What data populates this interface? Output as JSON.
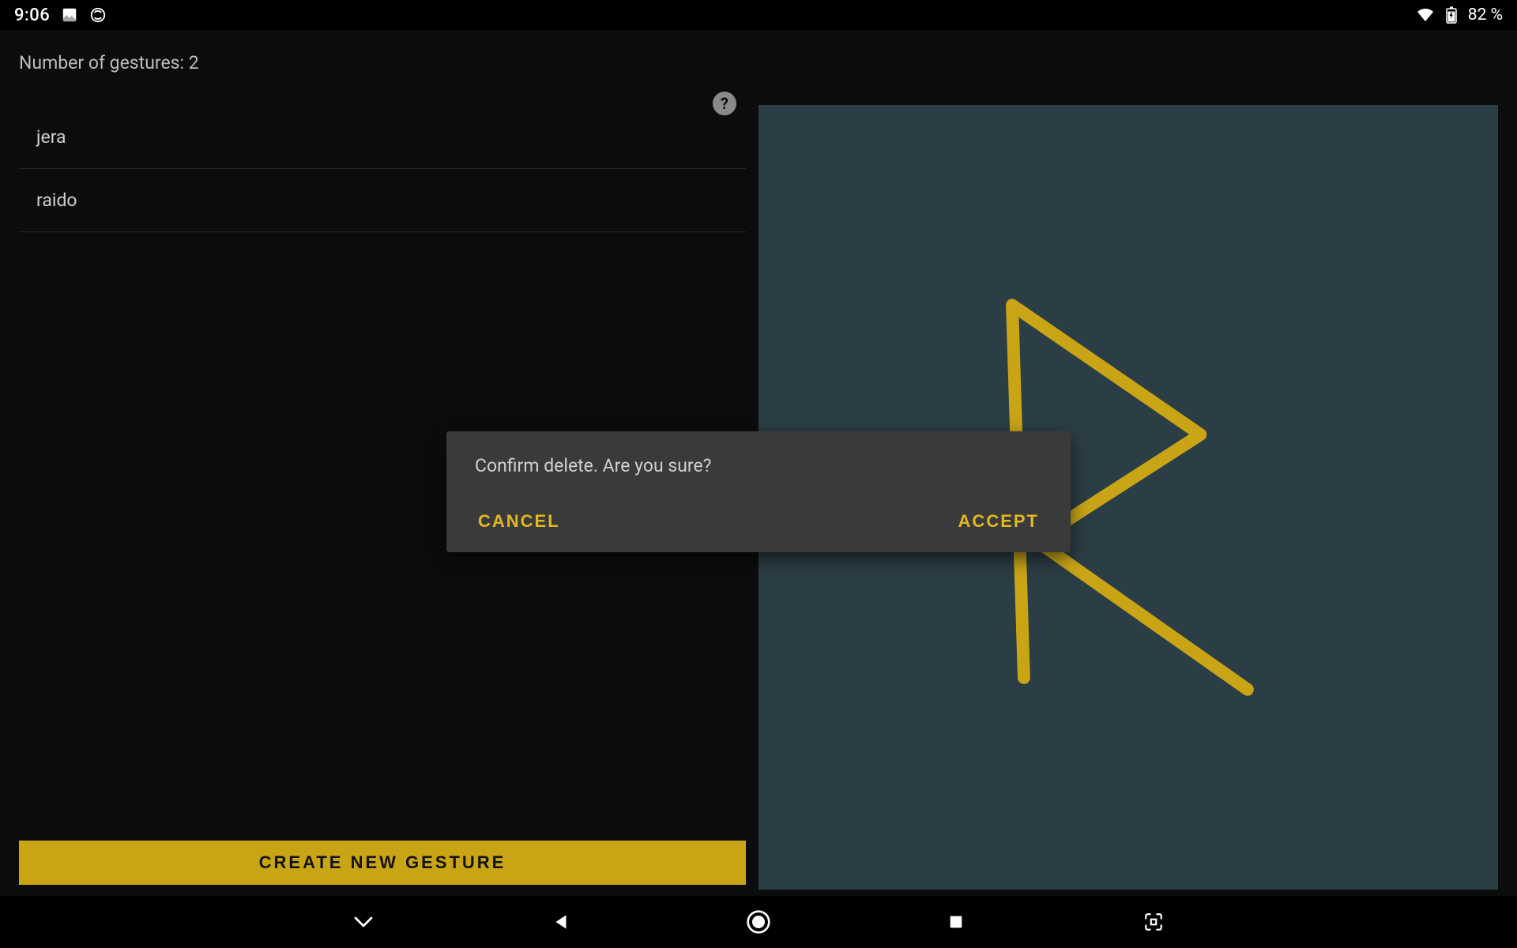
{
  "status": {
    "time": "9:06",
    "battery_text": "82 %"
  },
  "app": {
    "gesture_count_label": "Number of gestures: 2",
    "help_symbol": "?",
    "gestures": [
      {
        "name": "jera"
      },
      {
        "name": "raido"
      }
    ],
    "create_button_label": "CREATE NEW GESTURE"
  },
  "dialog": {
    "message": "Confirm delete. Are you sure?",
    "cancel_label": "CANCEL",
    "accept_label": "ACCEPT"
  },
  "colors": {
    "accent": "#c9a516",
    "canvas_bg": "#2c3e45",
    "dialog_bg": "#3a3a3a"
  }
}
